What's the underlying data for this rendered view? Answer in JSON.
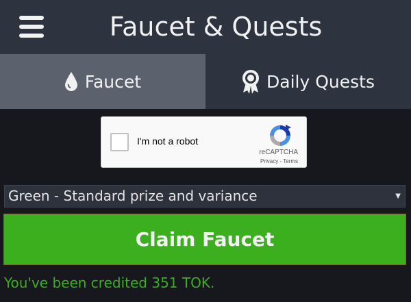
{
  "header": {
    "title": "Faucet & Quests",
    "menu_icon": "hamburger-menu-icon"
  },
  "tabs": [
    {
      "label": "Faucet",
      "icon": "droplet-icon",
      "active": true
    },
    {
      "label": "Daily Quests",
      "icon": "award-ribbon-icon",
      "active": false
    }
  ],
  "captcha": {
    "label": "I'm not a robot",
    "brand": "reCAPTCHA",
    "links": "Privacy - Terms",
    "checked": false
  },
  "prize_select": {
    "selected": "Green - Standard prize and variance"
  },
  "claim_button": {
    "label": "Claim Faucet"
  },
  "status": {
    "message": "You've been credited 351 TOK."
  },
  "colors": {
    "header_bg": "#2d3440",
    "active_tab_bg": "#5b626e",
    "page_bg": "#16181e",
    "accent_green": "#3caf1e"
  }
}
